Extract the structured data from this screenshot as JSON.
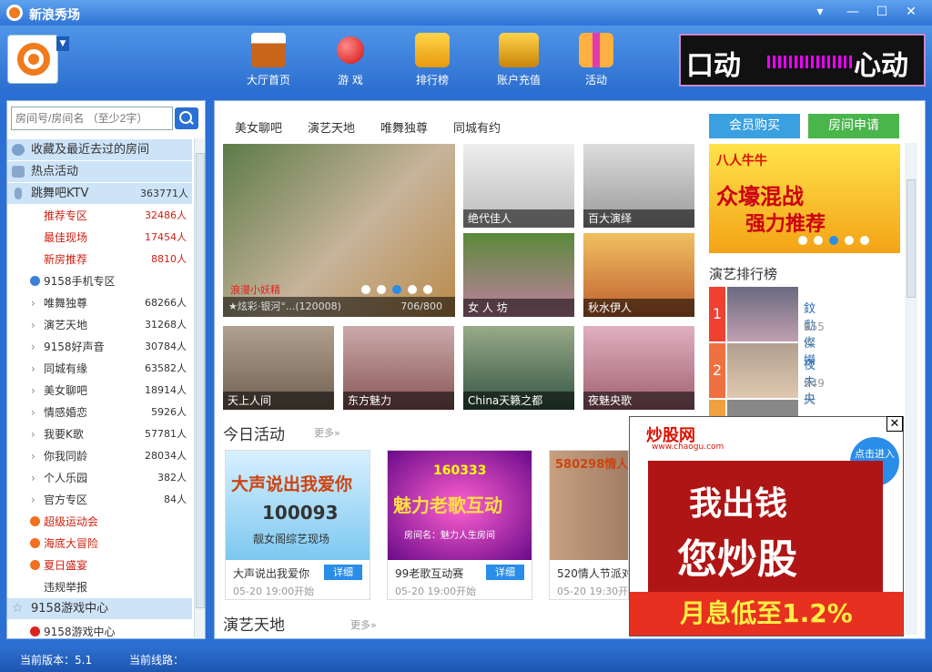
{
  "titlebar": {
    "title": "新浪秀场"
  },
  "toolbar": {
    "items": [
      {
        "label": "大厅首页",
        "icon": "house-icon"
      },
      {
        "label": "游 戏",
        "icon": "joystick-icon"
      },
      {
        "label": "排行榜",
        "icon": "podium-icon"
      },
      {
        "label": "账户充值",
        "icon": "wallet-icon"
      },
      {
        "label": "活动",
        "icon": "gift-icon"
      }
    ],
    "banner_left": "口动",
    "banner_right": "心动"
  },
  "sidebar": {
    "search_placeholder": "房间号/房间名 （至少2字）",
    "sections": [
      {
        "label": "收藏及最近去过的房间"
      },
      {
        "label": "热点活动"
      },
      {
        "label": "跳舞吧KTV",
        "count": "363771人"
      }
    ],
    "rows": [
      {
        "label": "推荐专区",
        "count": "32486人"
      },
      {
        "label": "最佳现场",
        "count": "17454人"
      },
      {
        "label": "新房推荐",
        "count": "8810人"
      },
      {
        "label": "9158手机专区",
        "count": ""
      },
      {
        "label": "唯舞独尊",
        "count": "68266人"
      },
      {
        "label": "演艺天地",
        "count": "31268人"
      },
      {
        "label": "9158好声音",
        "count": "30784人"
      },
      {
        "label": "同城有缘",
        "count": "63582人"
      },
      {
        "label": "美女聊吧",
        "count": "18914人"
      },
      {
        "label": "情感婚恋",
        "count": "5926人"
      },
      {
        "label": "我要K歌",
        "count": "57781人"
      },
      {
        "label": "你我同龄",
        "count": "28034人"
      },
      {
        "label": "个人乐园",
        "count": "382人"
      },
      {
        "label": "官方专区",
        "count": "84人"
      },
      {
        "label": "超级运动会",
        "count": ""
      },
      {
        "label": "海底大冒险",
        "count": ""
      },
      {
        "label": "夏日盛宴",
        "count": ""
      },
      {
        "label": "违规举报",
        "count": ""
      }
    ],
    "game_section": "9158游戏中心",
    "game_sub": "9158游戏中心"
  },
  "main": {
    "tabs": [
      "美女聊吧",
      "演艺天地",
      "唯舞独尊",
      "同城有约"
    ],
    "vip_button": "会员购买",
    "room_button": "房间申请",
    "hero": {
      "user": "浪漫小妖精",
      "caption": "★炫彩·银河°...(120008)",
      "seats": "706/800"
    },
    "thumbs": [
      "绝代佳人",
      "百大演绎",
      "女 人 坊",
      "秋水伊人",
      "天上人间",
      "东方魅力",
      "China天籁之都",
      "夜魅央歌"
    ],
    "ad_right": {
      "line1": "八人牛牛",
      "line2": "众壕混战",
      "line3": "强力推荐"
    },
    "rank_title": "演艺排行榜",
    "ranks": [
      {
        "num": "1",
        "name": "鈫勫儏嬫",
        "count": "955人"
      },
      {
        "num": "2",
        "name": "夜 未 央",
        "count": "949人"
      }
    ],
    "today_title": "今日活动",
    "more": "更多»",
    "cards": [
      {
        "title": "大声说出我爱你",
        "date": "05-20 19:00开始",
        "btn": "详细",
        "img_text": "大声说出我爱你",
        "img_num": "100093",
        "img_sub": "靓女阁综艺现场"
      },
      {
        "title": "99老歌互动赛",
        "date": "05-20 19:00开始",
        "btn": "详细",
        "img_text": "魅力老歌互动",
        "img_num": "160333",
        "img_sub": "房间名：魅力人生房间"
      },
      {
        "title": "520情人节派对",
        "date": "05-20 19:30开始",
        "btn": "详细",
        "img_text": "580298情人节",
        "img_num": "",
        "img_sub": ""
      }
    ],
    "section2_title": "演艺天地"
  },
  "popup": {
    "logo": "炒股网",
    "url": "www.chaogu.com",
    "cta": "点击进入",
    "line1": "我出钱",
    "line2": "您炒股",
    "line3": "月息低至1.2%"
  },
  "statusbar": {
    "version": "当前版本：5.1",
    "line": "当前线路："
  }
}
